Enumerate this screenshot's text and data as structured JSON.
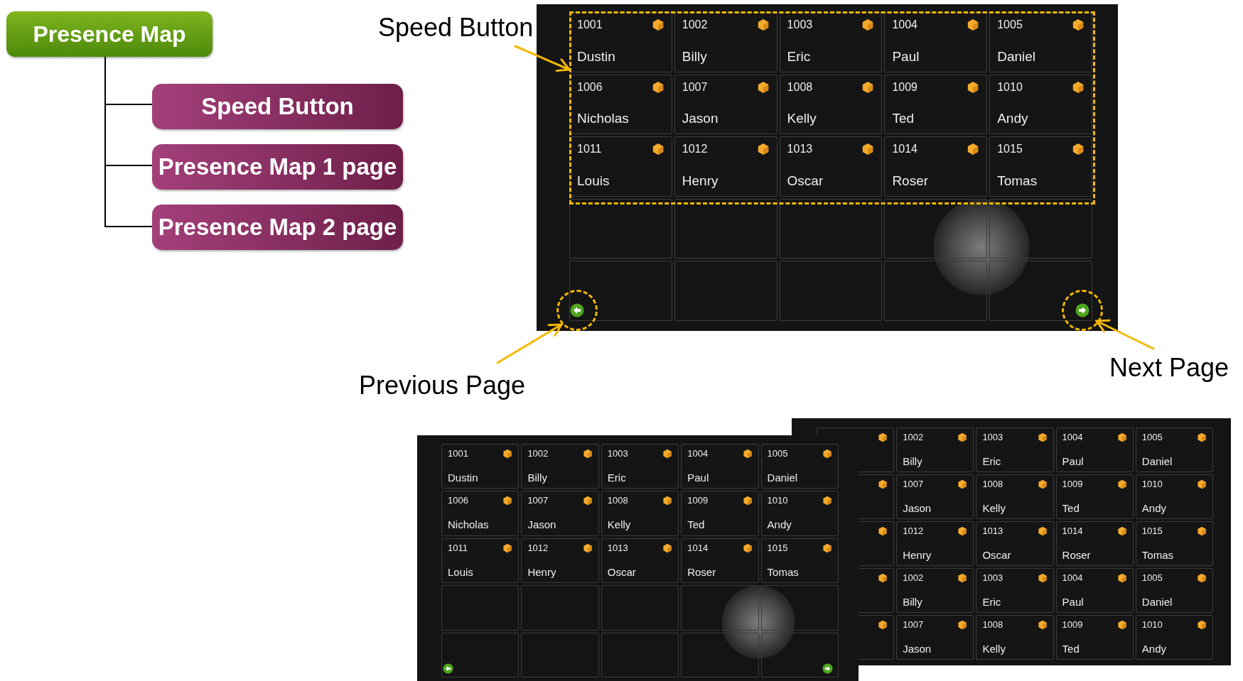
{
  "root_node": {
    "label": "Presence Map"
  },
  "child_nodes": [
    {
      "label": "Speed Button"
    },
    {
      "label": "Presence Map 1 page"
    },
    {
      "label": "Presence Map 2 page"
    }
  ],
  "callouts": [
    {
      "label": "Speed Button"
    },
    {
      "label": "Previous Page"
    },
    {
      "label": "Next Page"
    }
  ],
  "screens": [
    {
      "kind": "full",
      "cells": [
        {
          "kind": "speed",
          "number": "1001",
          "name": "Dustin"
        },
        {
          "kind": "speed",
          "number": "1002",
          "name": "Billy"
        },
        {
          "kind": "speed",
          "number": "1003",
          "name": "Eric"
        },
        {
          "kind": "speed",
          "number": "1004",
          "name": "Paul"
        },
        {
          "kind": "speed",
          "number": "1005",
          "name": "Daniel"
        },
        {
          "kind": "speed",
          "number": "1006",
          "name": "Nicholas"
        },
        {
          "kind": "speed",
          "number": "1007",
          "name": "Jason"
        },
        {
          "kind": "speed",
          "number": "1008",
          "name": "Kelly"
        },
        {
          "kind": "speed",
          "number": "1009",
          "name": "Ted"
        },
        {
          "kind": "speed",
          "number": "1010",
          "name": "Andy"
        },
        {
          "kind": "speed",
          "number": "1011",
          "name": "Louis"
        },
        {
          "kind": "speed",
          "number": "1012",
          "name": "Henry"
        },
        {
          "kind": "speed",
          "number": "1013",
          "name": "Oscar"
        },
        {
          "kind": "speed",
          "number": "1014",
          "name": "Roser"
        },
        {
          "kind": "speed",
          "number": "1015",
          "name": "Tomas"
        },
        {
          "kind": "empty"
        },
        {
          "kind": "empty"
        },
        {
          "kind": "empty"
        },
        {
          "kind": "empty"
        },
        {
          "kind": "empty"
        },
        {
          "kind": "empty"
        },
        {
          "kind": "empty"
        },
        {
          "kind": "empty"
        },
        {
          "kind": "empty"
        },
        {
          "kind": "empty"
        }
      ]
    },
    {
      "kind": "partial",
      "cells": [
        {
          "kind": "icon_only"
        },
        {
          "kind": "speed",
          "number": "1002",
          "name": "Billy"
        },
        {
          "kind": "speed",
          "number": "1003",
          "name": "Eric"
        },
        {
          "kind": "speed",
          "number": "1004",
          "name": "Paul"
        },
        {
          "kind": "speed",
          "number": "1005",
          "name": "Daniel"
        },
        {
          "kind": "icon_only"
        },
        {
          "kind": "speed",
          "number": "1007",
          "name": "Jason"
        },
        {
          "kind": "speed",
          "number": "1008",
          "name": "Kelly"
        },
        {
          "kind": "speed",
          "number": "1009",
          "name": "Ted"
        },
        {
          "kind": "speed",
          "number": "1010",
          "name": "Andy"
        },
        {
          "kind": "icon_only"
        },
        {
          "kind": "speed",
          "number": "1012",
          "name": "Henry"
        },
        {
          "kind": "speed",
          "number": "1013",
          "name": "Oscar"
        },
        {
          "kind": "speed",
          "number": "1014",
          "name": "Roser"
        },
        {
          "kind": "speed",
          "number": "1015",
          "name": "Tomas"
        },
        {
          "kind": "icon_only"
        },
        {
          "kind": "speed",
          "number": "1002",
          "name": "Billy"
        },
        {
          "kind": "speed",
          "number": "1003",
          "name": "Eric"
        },
        {
          "kind": "speed",
          "number": "1004",
          "name": "Paul"
        },
        {
          "kind": "speed",
          "number": "1005",
          "name": "Daniel"
        },
        {
          "kind": "icon_only"
        },
        {
          "kind": "speed",
          "number": "1007",
          "name": "Jason"
        },
        {
          "kind": "speed",
          "number": "1008",
          "name": "Kelly"
        },
        {
          "kind": "speed",
          "number": "1009",
          "name": "Ted"
        },
        {
          "kind": "speed",
          "number": "1010",
          "name": "Andy"
        }
      ]
    },
    {
      "kind": "full",
      "cells": [
        {
          "kind": "speed",
          "number": "1001",
          "name": "Dustin"
        },
        {
          "kind": "speed",
          "number": "1002",
          "name": "Billy"
        },
        {
          "kind": "speed",
          "number": "1003",
          "name": "Eric"
        },
        {
          "kind": "speed",
          "number": "1004",
          "name": "Paul"
        },
        {
          "kind": "speed",
          "number": "1005",
          "name": "Daniel"
        },
        {
          "kind": "speed",
          "number": "1006",
          "name": "Nicholas"
        },
        {
          "kind": "speed",
          "number": "1007",
          "name": "Jason"
        },
        {
          "kind": "speed",
          "number": "1008",
          "name": "Kelly"
        },
        {
          "kind": "speed",
          "number": "1009",
          "name": "Ted"
        },
        {
          "kind": "speed",
          "number": "1010",
          "name": "Andy"
        },
        {
          "kind": "speed",
          "number": "1011",
          "name": "Louis"
        },
        {
          "kind": "speed",
          "number": "1012",
          "name": "Henry"
        },
        {
          "kind": "speed",
          "number": "1013",
          "name": "Oscar"
        },
        {
          "kind": "speed",
          "number": "1014",
          "name": "Roser"
        },
        {
          "kind": "speed",
          "number": "1015",
          "name": "Tomas"
        },
        {
          "kind": "empty"
        },
        {
          "kind": "empty"
        },
        {
          "kind": "empty"
        },
        {
          "kind": "empty"
        },
        {
          "kind": "empty"
        },
        {
          "kind": "empty"
        },
        {
          "kind": "empty"
        },
        {
          "kind": "empty"
        },
        {
          "kind": "empty"
        },
        {
          "kind": "empty"
        }
      ]
    }
  ]
}
